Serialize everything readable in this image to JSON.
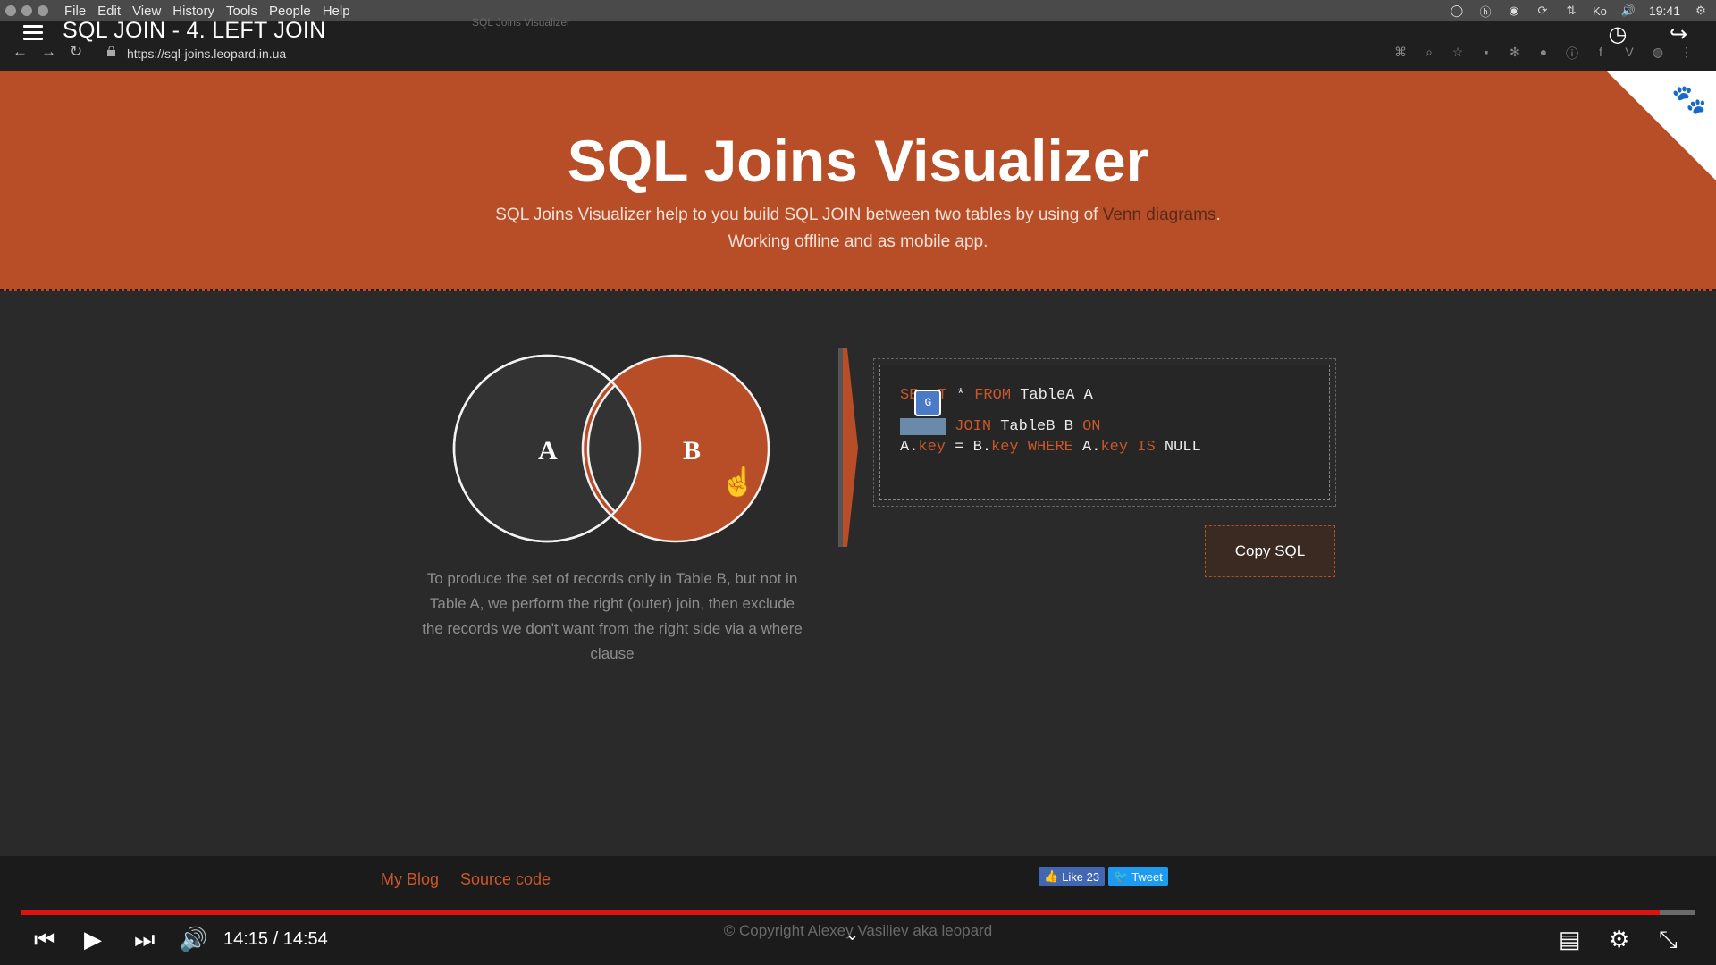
{
  "system": {
    "menu": [
      "File",
      "Edit",
      "View",
      "History",
      "Tools",
      "People",
      "Help"
    ],
    "clock": "19:41",
    "tray_label": "Ko"
  },
  "video": {
    "title": "SQL JOIN - 4. LEFT JOIN",
    "time": "14:15 / 14:54",
    "progress": 0.979
  },
  "browser": {
    "tab_title": "SQL Joins Visualizer",
    "url": "https://sql-joins.leopard.in.ua"
  },
  "hero": {
    "title": "SQL Joins Visualizer",
    "line1_pre": "SQL Joins Visualizer help to you build SQL JOIN between two tables by using of ",
    "line1_link": "Venn diagrams",
    "line1_post": ".",
    "line2": "Working offline and as mobile app."
  },
  "venn": {
    "label_a": "A",
    "label_b": "B",
    "highlight_color": "#b84e27",
    "base_color": "#333333"
  },
  "description": "To produce the set of records only in Table B, but not in Table A, we perform the right (outer) join, then exclude the records we don't want from the right side via a where clause",
  "sql": {
    "l1_a": "SE",
    "l1_b": "T",
    "l1_c": " * ",
    "l1_from": "FROM",
    "l1_d": " TableA A",
    "l2_right": "RIGHT",
    "l2_join": " JOIN",
    "l2_b": " TableB B ",
    "l2_on": "ON",
    "l3_a": "A.",
    "l3_key1": "key",
    "l3_b": " = B.",
    "l3_key2": "key",
    "l3_where": " WHERE",
    "l3_c": " A.",
    "l3_key3": "key",
    "l3_is": " IS",
    "l3_null": " NULL"
  },
  "buttons": {
    "copy_sql": "Copy SQL"
  },
  "footer": {
    "blog": "My Blog",
    "source": "Source code",
    "like": "Like 23",
    "tweet": "Tweet",
    "copyright": "© Copyright Alexey Vasiliev aka leopard"
  },
  "colors": {
    "accent": "#b84e27",
    "progress": "#e11111"
  }
}
